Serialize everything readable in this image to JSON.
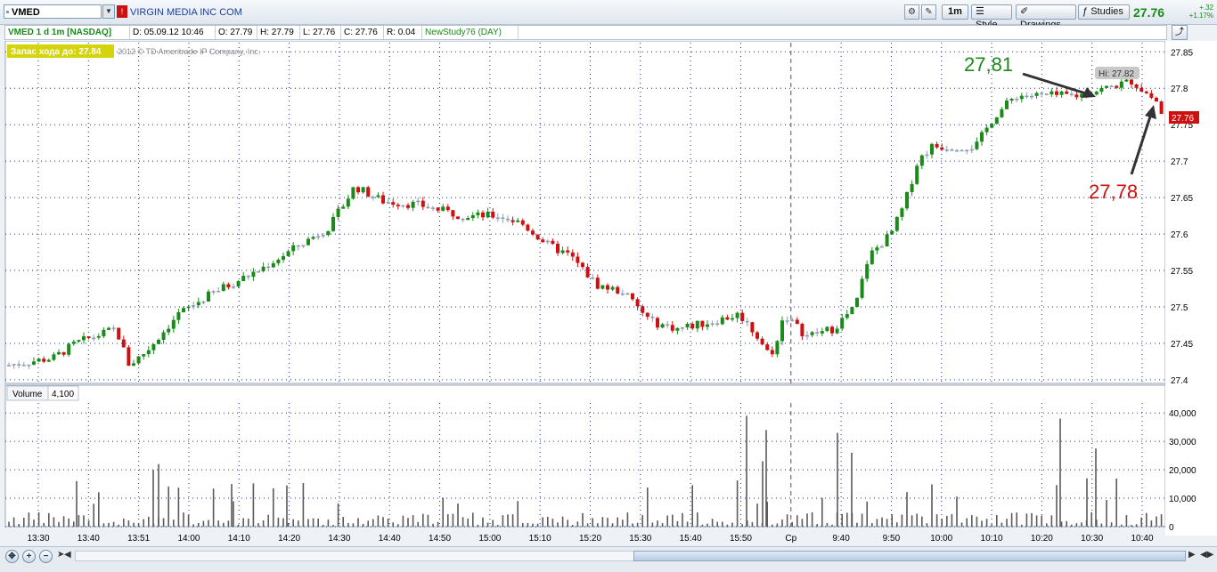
{
  "toolbar": {
    "symbol": "VMED",
    "company": "VIRGIN MEDIA INC COM",
    "timeframe_button": "1m",
    "style_button": "Style",
    "drawings_button": "Drawings",
    "studies_button": "Studies",
    "last_price": "27.76",
    "change_abs": "+.32",
    "change_pct": "+1.17%"
  },
  "infobar": {
    "title": "VMED 1 d 1m [NASDAQ]",
    "date": "D: 05.09.12 10:46",
    "open": "O: 27.79",
    "high": "H: 27.79",
    "low": "L: 27.76",
    "close": "C: 27.76",
    "range": "R: 0.04",
    "study": "NewStudy76 (DAY)"
  },
  "chart_overlay": {
    "badge": "Запас хода до: 27.84",
    "copyright": "2012 © TD Ameritrade IP Company, Inc.",
    "annotation_high": "27,81",
    "annotation_last": "27,78",
    "hi_label": "Hi: 27.82",
    "price_tag": "27.76"
  },
  "colors": {
    "up": "#1a8a1a",
    "down": "#cc1111",
    "flat": "#8a9bb0",
    "grid": "#1a2f9a",
    "volume": "#5a5a5a",
    "badge_bg": "#d4d40a",
    "annotation_high": "#1a8a1a",
    "annotation_last": "#cc1111"
  },
  "chart_data": {
    "type": "candlestick",
    "symbol": "VMED",
    "interval": "1m",
    "price_axis": {
      "ticks": [
        "27.85",
        "27.8",
        "27.75",
        "27.7",
        "27.65",
        "27.6",
        "27.55",
        "27.5",
        "27.45",
        "27.4"
      ],
      "ylim": [
        27.395,
        27.865
      ]
    },
    "volume_axis": {
      "label": "Volume",
      "current": "4,100",
      "ticks": [
        "40,000",
        "30,000",
        "20,000",
        "10,000",
        "0"
      ],
      "ylim": [
        0,
        41000
      ]
    },
    "time_labels": [
      "13:30",
      "13:40",
      "13:51",
      "14:00",
      "14:10",
      "14:20",
      "14:30",
      "14:40",
      "14:50",
      "15:00",
      "15:10",
      "15:20",
      "15:30",
      "15:40",
      "15:50",
      "Ср",
      "9:40",
      "9:50",
      "10:00",
      "10:10",
      "10:20",
      "10:30",
      "10:40"
    ],
    "day_separator_label": "Ср",
    "hi": 27.82,
    "last": 27.76,
    "grid": true
  }
}
